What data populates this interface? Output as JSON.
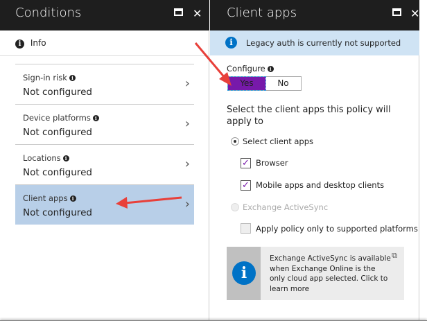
{
  "conditions": {
    "title": "Conditions",
    "info_label": "Info",
    "items": [
      {
        "label": "Sign-in risk",
        "value": "Not configured"
      },
      {
        "label": "Device platforms",
        "value": "Not configured"
      },
      {
        "label": "Locations",
        "value": "Not configured"
      },
      {
        "label": "Client apps",
        "value": "Not configured",
        "selected": true
      }
    ]
  },
  "client_apps": {
    "title": "Client apps",
    "banner": "Legacy auth is currently not supported",
    "configure_label": "Configure",
    "toggle": {
      "yes": "Yes",
      "no": "No",
      "selected": "Yes"
    },
    "prompt": "Select the client apps this policy will apply to",
    "radio_select": "Select client apps",
    "browser": "Browser",
    "mobile": "Mobile apps and desktop clients",
    "eas": "Exchange ActiveSync",
    "apply_policy": "Apply policy only to supported platforms",
    "info_box": "Exchange ActiveSync is available when Exchange Online is the only cloud app selected. Click to learn more"
  },
  "colors": {
    "header": "#1e1e1e",
    "accent": "#7719aa",
    "selected": "#b8cfe8",
    "banner": "#cfe3f4",
    "info_blue": "#0072c6",
    "arrow": "#e8403a"
  }
}
